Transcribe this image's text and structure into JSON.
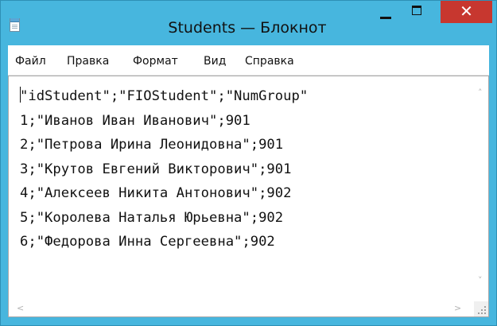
{
  "window": {
    "title": "Students — Блокнот",
    "accent_color": "#47b6de",
    "close_color": "#c7372f",
    "controls": {
      "minimize_icon": "minimize-icon",
      "maximize_icon": "maximize-icon",
      "close_glyph": "✕"
    }
  },
  "menu": {
    "items": [
      {
        "label": "Файл"
      },
      {
        "label": "Правка"
      },
      {
        "label": "Формат"
      },
      {
        "label": "Вид"
      },
      {
        "label": "Справка"
      }
    ]
  },
  "document": {
    "lines": [
      "\"idStudent\";\"FIOStudent\";\"NumGroup\"",
      "1;\"Иванов Иван Иванович\";901",
      "2;\"Петрова Ирина Леонидовна\";901",
      "3;\"Крутов Евгений Викторович\";901",
      "4;\"Алексеев Никита Антонович\";902",
      "5;\"Королева Наталья Юрьевна\";902",
      "6;\"Федорова Инна Сергеевна\";902"
    ]
  },
  "scrollbars": {
    "up_arrow": "˄",
    "down_arrow": "˅",
    "left_arrow": "<",
    "right_arrow": ">"
  }
}
